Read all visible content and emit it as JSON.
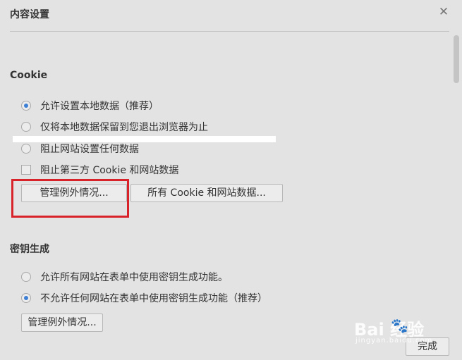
{
  "dialog": {
    "title": "内容设置",
    "close_symbol": "✕"
  },
  "cookie": {
    "heading": "Cookie",
    "options": [
      {
        "label": "允许设置本地数据（推荐）",
        "type": "radio",
        "selected": true
      },
      {
        "label": "仅将本地数据保留到您退出浏览器为止",
        "type": "radio",
        "selected": false
      },
      {
        "label": "阻止网站设置任何数据",
        "type": "radio",
        "selected": false
      },
      {
        "label": "阻止第三方 Cookie 和网站数据",
        "type": "checkbox",
        "checked": false
      }
    ],
    "manage_exceptions_label": "管理例外情况...",
    "all_cookies_label": "所有 Cookie 和网站数据..."
  },
  "keygen": {
    "heading": "密钥生成",
    "options": [
      {
        "label": "允许所有网站在表单中使用密钥生成功能。",
        "type": "radio",
        "selected": false
      },
      {
        "label": "不允许任何网站在表单中使用密钥生成功能（推荐）",
        "type": "radio",
        "selected": true
      }
    ],
    "manage_exceptions_label": "管理例外情况..."
  },
  "footer": {
    "done_label": "完成"
  },
  "watermark": {
    "logo": "Bai   经验",
    "sub": "jingyan.baidu.com"
  },
  "colors": {
    "accent": "#3d7fd4",
    "highlight": "#d8232a",
    "background": "#e3e3e3"
  }
}
